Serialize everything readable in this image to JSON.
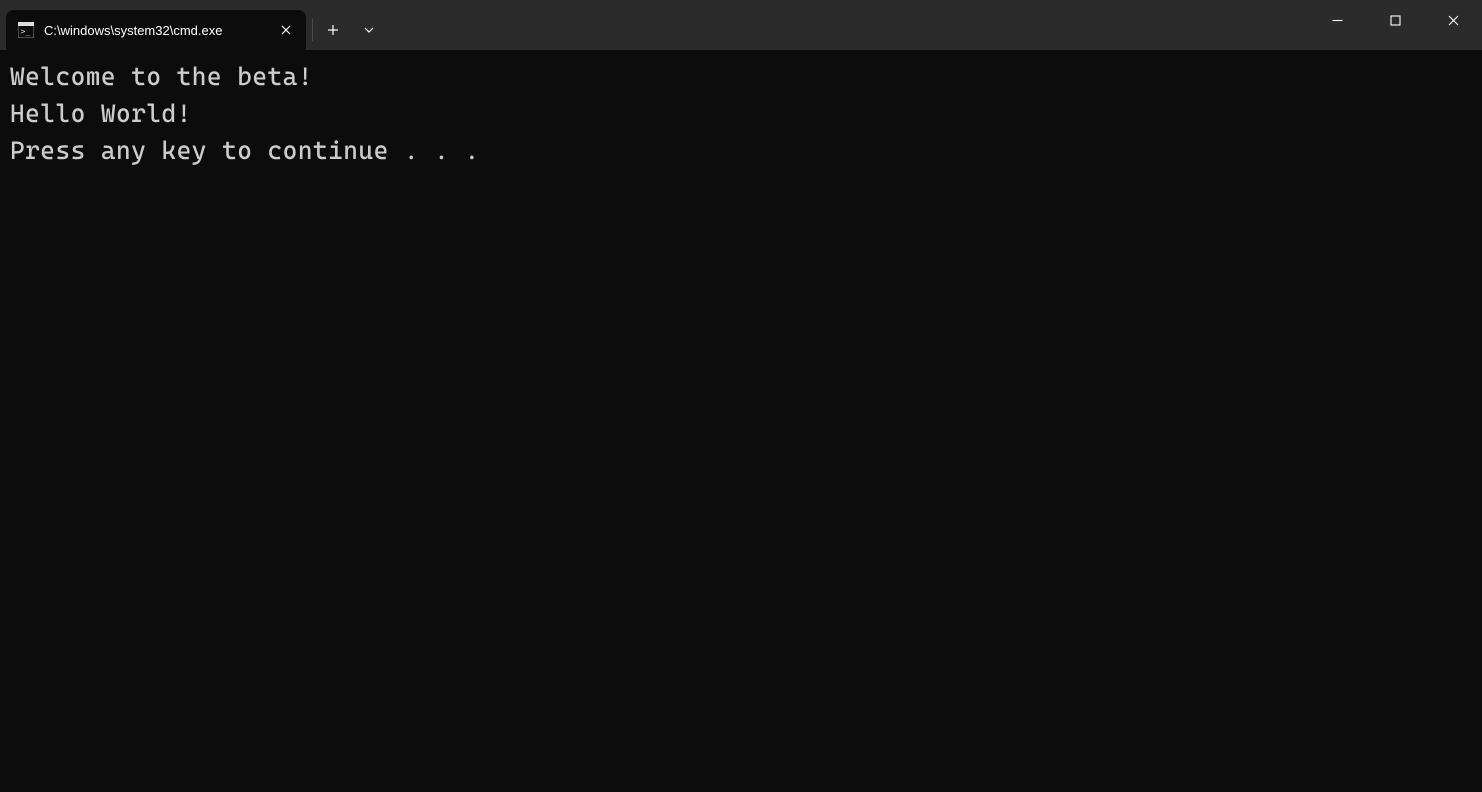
{
  "tab": {
    "title": "C:\\windows\\system32\\cmd.exe"
  },
  "terminal": {
    "lines": [
      "Welcome to the beta!",
      "Hello World!",
      "Press any key to continue . . ."
    ]
  }
}
